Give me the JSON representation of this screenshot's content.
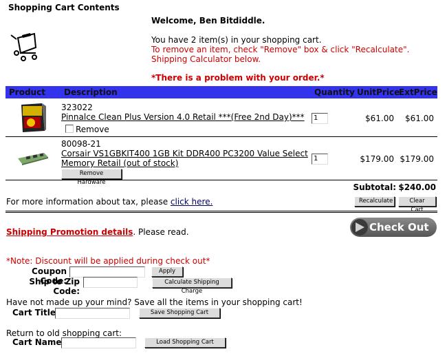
{
  "page_title": "Shopping Cart Contents",
  "welcome": "Welcome, Ben Bitdiddle.",
  "cart_info": {
    "count_text": "You have 2 item(s) in your shopping cart.",
    "remove_instructions": "To remove an item, check \"Remove\" box & click \"Recalculate\".",
    "calculator_hint": "Shipping Calculator below."
  },
  "problem_text": "*There is a problem with your order.*",
  "table": {
    "headers": {
      "product": "Product",
      "description": "Description",
      "quantity": "Quantity",
      "unit_price": "UnitPrice",
      "ext_price": "ExtPrice"
    },
    "items": [
      {
        "sku": "323022",
        "name": "Pinnalce Clean Plus Version 4.0 Retail ***(Free 2nd Day)***",
        "remove_label": "Remove",
        "quantity": "1",
        "unit_price": "$61.00",
        "ext_price": "$61.00"
      },
      {
        "sku": "80098-21",
        "name_line1": "Corsair VS1GBKIT400 1GB Kit DDR400 PC3200 Value Select",
        "name_line2": "Memory Retail (out of stock)",
        "remove_button": "Remove Hardware",
        "quantity": "1",
        "unit_price": "$179.00",
        "ext_price": "$179.00"
      }
    ],
    "subtotal_label": "Subtotal:",
    "subtotal_value": "$240.00"
  },
  "tax_info": {
    "text": "For more information about tax, please ",
    "link": "click here."
  },
  "buttons": {
    "recalculate": "Recalculate",
    "clear_cart": "Clear Cart",
    "check_out": "Check Out",
    "apply": "Apply",
    "calculate_shipping": "Calculate Shipping Charge",
    "save_cart": "Save Shopping Cart",
    "load_cart": "Load Shopping Cart"
  },
  "shipping_promo": {
    "link": "Shipping Promotion details",
    "suffix": ". Please read."
  },
  "discount_note": "*Note: Discount will be applied during check out*",
  "coupon_label": "Coupon Code:",
  "zip_label": "Ship to Zip Code:",
  "save_prompt": "Have not made up your mind? Save all the items in your shopping cart!",
  "cart_title_label": "Cart Title:",
  "return_prompt": "Return to old shopping cart:",
  "cart_name_label": "Cart Name:",
  "colors": {
    "header_bar": "#3333ee",
    "alert_red": "#cc0000",
    "checkout_button": "#6e6e6e"
  },
  "icons": {
    "cart": "shopping-cart-icon"
  }
}
